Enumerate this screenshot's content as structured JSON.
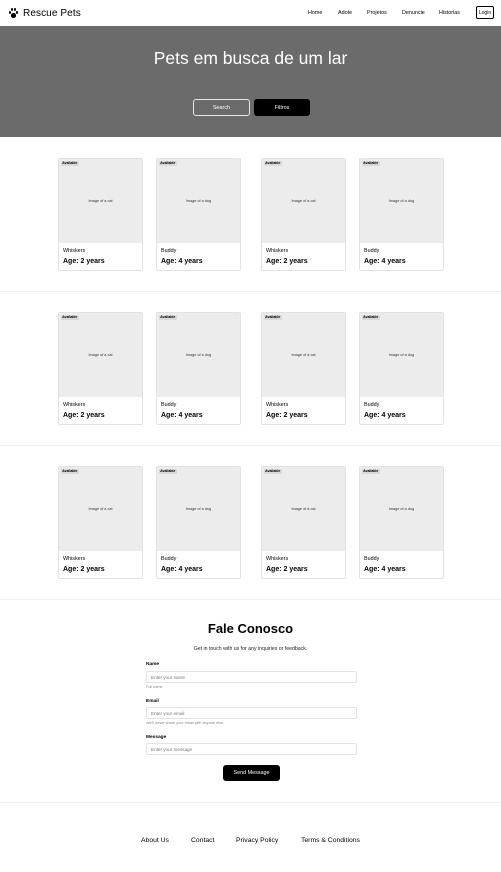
{
  "header": {
    "brand": "Rescue Pets",
    "nav": [
      "Home",
      "Adote",
      "Projetos",
      "Denuncie",
      "Historias"
    ],
    "login": "Login"
  },
  "hero": {
    "title": "Pets em busca de um lar",
    "search_label": "Search",
    "filter_label": "Filtros"
  },
  "pets": [
    {
      "status": "Available",
      "image_alt": "Image of a cat",
      "name": "Whiskers",
      "age": "Age: 2 years"
    },
    {
      "status": "Available",
      "image_alt": "Image of a dog",
      "name": "Buddy",
      "age": "Age: 4 years"
    },
    {
      "status": "Available",
      "image_alt": "Image of a cat",
      "name": "Whiskers",
      "age": "Age: 2 years"
    },
    {
      "status": "Available",
      "image_alt": "Image of a dog",
      "name": "Buddy",
      "age": "Age: 4 years"
    }
  ],
  "contact": {
    "title": "Fale Conosco",
    "subtitle": "Get in touch with us for any inquiries or feedback.",
    "name_label": "Name",
    "name_placeholder": "Enter your name",
    "name_help": "Full name",
    "email_label": "Email",
    "email_placeholder": "Enter your email",
    "email_help": "We'll never share your email with anyone else.",
    "message_label": "Message",
    "message_placeholder": "Enter your message",
    "send_label": "Send Message"
  },
  "footer": {
    "links": [
      "About Us",
      "Contact",
      "Privacy Policy",
      "Terms & Conditions"
    ]
  },
  "colors": {
    "hero_bg": "#6b6b6b",
    "button_dark": "#000000",
    "card_image_bg": "#ececec"
  }
}
